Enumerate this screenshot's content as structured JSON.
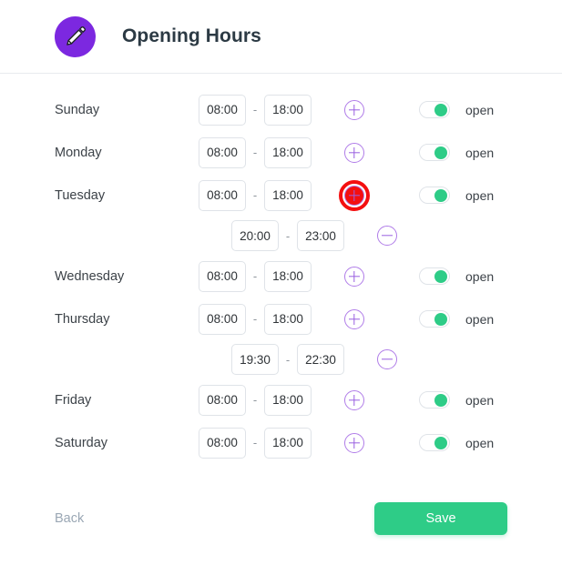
{
  "header": {
    "title": "Opening Hours",
    "avatar_icon": "pencil-icon",
    "avatar_color": "#7c28e0"
  },
  "colors": {
    "accent_purple": "#9a5fe0",
    "toggle_green": "#2ecc87",
    "save_green": "#2ecc87",
    "highlight_red": "#f40f10",
    "text": "#3c4248",
    "muted": "#9aa7b4"
  },
  "separator": "-",
  "days": [
    {
      "label": "Sunday",
      "open_label": "open",
      "is_open": true,
      "ranges": [
        {
          "from": "08:00",
          "to": "18:00",
          "action": "add",
          "highlighted": false
        }
      ]
    },
    {
      "label": "Monday",
      "open_label": "open",
      "is_open": true,
      "ranges": [
        {
          "from": "08:00",
          "to": "18:00",
          "action": "add",
          "highlighted": false
        }
      ]
    },
    {
      "label": "Tuesday",
      "open_label": "open",
      "is_open": true,
      "ranges": [
        {
          "from": "08:00",
          "to": "18:00",
          "action": "add",
          "highlighted": true
        },
        {
          "from": "20:00",
          "to": "23:00",
          "action": "remove",
          "highlighted": false
        }
      ]
    },
    {
      "label": "Wednesday",
      "open_label": "open",
      "is_open": true,
      "ranges": [
        {
          "from": "08:00",
          "to": "18:00",
          "action": "add",
          "highlighted": false
        }
      ]
    },
    {
      "label": "Thursday",
      "open_label": "open",
      "is_open": true,
      "ranges": [
        {
          "from": "08:00",
          "to": "18:00",
          "action": "add",
          "highlighted": false
        },
        {
          "from": "19:30",
          "to": "22:30",
          "action": "remove",
          "highlighted": false
        }
      ]
    },
    {
      "label": "Friday",
      "open_label": "open",
      "is_open": true,
      "ranges": [
        {
          "from": "08:00",
          "to": "18:00",
          "action": "add",
          "highlighted": false
        }
      ]
    },
    {
      "label": "Saturday",
      "open_label": "open",
      "is_open": true,
      "ranges": [
        {
          "from": "08:00",
          "to": "18:00",
          "action": "add",
          "highlighted": false
        }
      ]
    }
  ],
  "footer": {
    "back_label": "Back",
    "save_label": "Save"
  }
}
